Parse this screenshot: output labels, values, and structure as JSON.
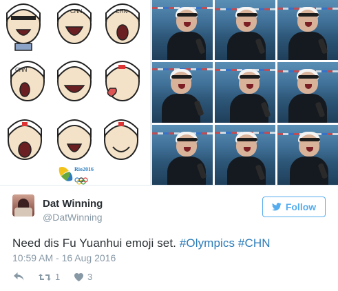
{
  "media": {
    "left_caption_logo": "Rio2016",
    "photo_count": 9
  },
  "tweet": {
    "display_name": "Dat Winning",
    "handle": "@DatWinning",
    "follow_label": "Follow",
    "text_before": "Need dis Fu Yuanhui emoji set.",
    "hashtag_1": "#Olympics",
    "hashtag_2": "#CHN",
    "timestamp": "10:59 AM - 16 Aug 2016",
    "reply_count": "",
    "retweet_count": "1",
    "like_count": "3"
  }
}
